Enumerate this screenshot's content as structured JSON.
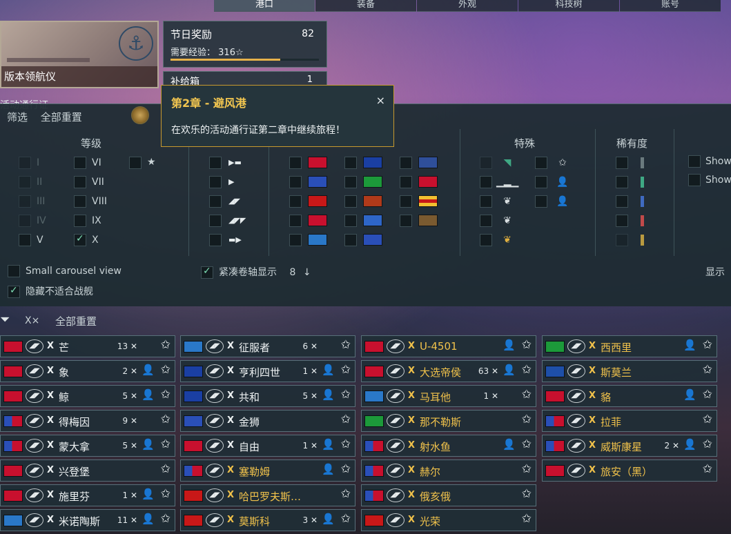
{
  "nav": {
    "tabs": [
      "港口",
      "装备",
      "外观",
      "科技树",
      "账号"
    ],
    "active": 0
  },
  "event_card": {
    "label": "版本领航仪"
  },
  "next_card": {
    "label": "活动通行证"
  },
  "reward": {
    "title": "节日奖励",
    "value": "82",
    "xp_label": "需要经验：",
    "xp_value": "316☆",
    "progress": 0.74
  },
  "supply": {
    "title": "补给箱",
    "value": "1"
  },
  "tooltip": {
    "title": "第2章 - 避风港",
    "body": "在欢乐的活动通行证第二章中继续旅程！",
    "close": "×"
  },
  "filter": {
    "head": [
      "筛选",
      "全部重置"
    ],
    "tier_title": "等级",
    "special_title": "特殊",
    "rarity_title": "稀有度",
    "tiers_col1": [
      "I",
      "II",
      "III",
      "IV",
      "V"
    ],
    "tiers_col2": [
      "VI",
      "VII",
      "VIII",
      "IX",
      "X"
    ],
    "tier_star": "★",
    "show_labels": [
      "Show",
      "Show"
    ],
    "small_carousel": "Small carousel view",
    "compact": "紧凑卷轴显示",
    "compact_value": "8",
    "hide_unsuitable": "隐藏不适合战舰",
    "show_right": "显示",
    "rarity_colors": [
      "#6a7a7e",
      "#3fa884",
      "#3f6ac0",
      "#c04a4a",
      "#b89a40"
    ]
  },
  "filterbar": {
    "chip": "X×",
    "reset": "全部重置"
  },
  "columns": [
    [
      {
        "flag": "swiss",
        "tier": "X",
        "name": "芒",
        "count": "13",
        "person": false,
        "gold": false
      },
      {
        "flag": "swiss",
        "tier": "X",
        "name": "象",
        "count": "2",
        "person": true,
        "gold": false
      },
      {
        "flag": "swiss",
        "tier": "X",
        "name": "鲸",
        "count": "5",
        "person": true,
        "gold": false
      },
      {
        "flag": "uk-b",
        "tier": "X",
        "name": "得梅因",
        "count": "9",
        "person": false,
        "gold": false
      },
      {
        "flag": "uk-b",
        "tier": "X",
        "name": "蒙大拿",
        "count": "5",
        "person": true,
        "gold": false
      },
      {
        "flag": "de",
        "tier": "X",
        "name": "兴登堡",
        "count": "",
        "person": false,
        "gold": false
      },
      {
        "flag": "de",
        "tier": "X",
        "name": "施里芬",
        "count": "1",
        "person": true,
        "gold": false
      },
      {
        "flag": "pan",
        "tier": "X",
        "name": "米诺陶斯",
        "count": "11",
        "person": true,
        "gold": false
      }
    ],
    [
      {
        "flag": "pan",
        "tier": "X",
        "name": "征服者",
        "count": "6",
        "person": false,
        "gold": false
      },
      {
        "flag": "fr",
        "tier": "X",
        "name": "亨利四世",
        "count": "1",
        "person": true,
        "gold": false
      },
      {
        "flag": "fr",
        "tier": "X",
        "name": "共和",
        "count": "5",
        "person": true,
        "gold": false
      },
      {
        "flag": "nl",
        "tier": "X",
        "name": "金狮",
        "count": "",
        "person": false,
        "gold": false
      },
      {
        "flag": "es",
        "tier": "X",
        "name": "自由",
        "count": "1",
        "person": true,
        "gold": false
      },
      {
        "flag": "uk-b",
        "tier": "X",
        "name": "塞勒姆",
        "count": "",
        "person": true,
        "gold": true
      },
      {
        "flag": "ussr",
        "tier": "X",
        "name": "哈巴罗夫斯…",
        "count": "",
        "person": false,
        "gold": true
      },
      {
        "flag": "ussr",
        "tier": "X",
        "name": "莫斯科",
        "count": "3",
        "person": true,
        "gold": true
      }
    ],
    [
      {
        "flag": "de",
        "tier": "X",
        "name": "U-4501",
        "count": "",
        "person": true,
        "gold": true
      },
      {
        "flag": "de",
        "tier": "X",
        "name": "大选帝侯",
        "count": "63",
        "person": true,
        "gold": true
      },
      {
        "flag": "pan",
        "tier": "X",
        "name": "马耳他",
        "count": "1",
        "person": false,
        "gold": true
      },
      {
        "flag": "it",
        "tier": "X",
        "name": "那不勒斯",
        "count": "",
        "person": false,
        "gold": true
      },
      {
        "flag": "uk-b",
        "tier": "X",
        "name": "射水鱼",
        "count": "",
        "person": true,
        "gold": true
      },
      {
        "flag": "uk-b",
        "tier": "X",
        "name": "赫尔",
        "count": "",
        "person": false,
        "gold": true
      },
      {
        "flag": "uk-b",
        "tier": "X",
        "name": "俄亥俄",
        "count": "",
        "person": false,
        "gold": true
      },
      {
        "flag": "ussr",
        "tier": "X",
        "name": "光荣",
        "count": "",
        "person": false,
        "gold": true
      }
    ],
    [
      {
        "flag": "it",
        "tier": "X",
        "name": "西西里",
        "count": "",
        "person": true,
        "gold": true
      },
      {
        "flag": "se",
        "tier": "X",
        "name": "斯莫兰",
        "count": "",
        "person": false,
        "gold": true
      },
      {
        "flag": "swiss",
        "tier": "X",
        "name": "貉",
        "count": "",
        "person": true,
        "gold": true
      },
      {
        "flag": "uk-b",
        "tier": "X",
        "name": "拉菲",
        "count": "",
        "person": false,
        "gold": true
      },
      {
        "flag": "uk-b",
        "tier": "X",
        "name": "威斯康星",
        "count": "2",
        "person": true,
        "gold": true
      },
      {
        "flag": "es",
        "tier": "X",
        "name": "旅安（黑）",
        "count": "",
        "person": false,
        "gold": true
      }
    ]
  ]
}
